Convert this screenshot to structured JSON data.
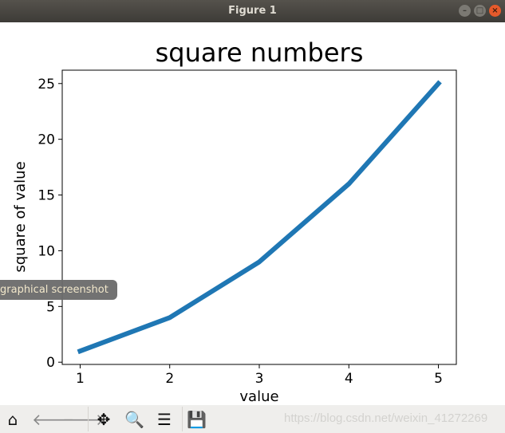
{
  "window": {
    "title": "Figure 1"
  },
  "toolbar": {
    "buttons": [
      {
        "name": "home-icon",
        "glyph": "⌂",
        "enabled": true
      },
      {
        "name": "back-arrow-icon",
        "glyph": "🡐",
        "enabled": false
      },
      {
        "name": "forward-arrow-icon",
        "glyph": "🡒",
        "enabled": false
      },
      {
        "name": "pan-icon",
        "glyph": "✥",
        "enabled": true
      },
      {
        "name": "zoom-icon",
        "glyph": "🔍",
        "enabled": true
      },
      {
        "name": "configure-subplots-icon",
        "glyph": "☰",
        "enabled": true
      },
      {
        "name": "save-icon",
        "glyph": "💾",
        "enabled": true
      }
    ]
  },
  "tooltip": "graphical screenshot",
  "watermark": "https://blog.csdn.net/weixin_41272269",
  "chart_data": {
    "type": "line",
    "title": "square numbers",
    "xlabel": "value",
    "ylabel": "square of value",
    "x": [
      1,
      2,
      3,
      4,
      5
    ],
    "series": [
      {
        "values": [
          1,
          4,
          9,
          16,
          25
        ],
        "color": "#1f77b4"
      }
    ],
    "xlim": [
      0.8,
      5.2
    ],
    "ylim": [
      -0.2,
      26.2
    ],
    "xticks": [
      "1",
      "2",
      "3",
      "4",
      "5"
    ],
    "yticks": [
      "0",
      "5",
      "10",
      "15",
      "20",
      "25"
    ],
    "grid": false
  }
}
